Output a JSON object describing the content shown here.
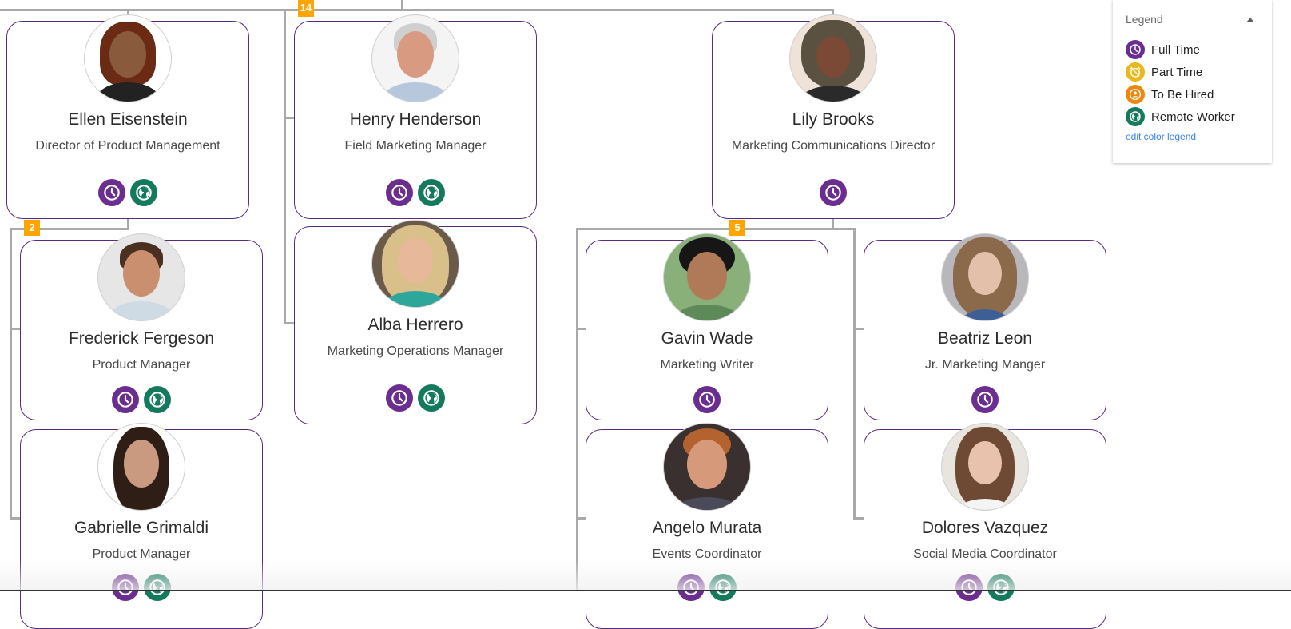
{
  "legend": {
    "title": "Legend",
    "items": [
      {
        "label": "Full Time",
        "icon": "clock-icon",
        "color": "#6b2d8f"
      },
      {
        "label": "Part Time",
        "icon": "alarm-off-icon",
        "color": "#e8b81c"
      },
      {
        "label": "To Be Hired",
        "icon": "person-icon",
        "color": "#f0870c"
      },
      {
        "label": "Remote Worker",
        "icon": "globe-icon",
        "color": "#137a5e"
      }
    ],
    "edit_link": "edit color legend"
  },
  "badges": {
    "top_group_count": "14",
    "ellen_reports_count": "2",
    "lily_reports_count": "5"
  },
  "people": [
    {
      "id": "ellen",
      "name": "Ellen Eisenstein",
      "title": "Director of Product Management",
      "status": [
        "full-time",
        "remote"
      ]
    },
    {
      "id": "henry",
      "name": "Henry Henderson",
      "title": "Field Marketing Manager",
      "status": [
        "full-time",
        "remote"
      ]
    },
    {
      "id": "lily",
      "name": "Lily Brooks",
      "title": "Marketing Communications Director",
      "status": [
        "full-time"
      ]
    },
    {
      "id": "frederick",
      "name": "Frederick Fergeson",
      "title": "Product Manager",
      "status": [
        "full-time",
        "remote"
      ]
    },
    {
      "id": "alba",
      "name": "Alba Herrero",
      "title": "Marketing Operations Manager",
      "status": [
        "full-time",
        "remote"
      ]
    },
    {
      "id": "gavin",
      "name": "Gavin Wade",
      "title": "Marketing Writer",
      "status": [
        "full-time"
      ]
    },
    {
      "id": "beatriz",
      "name": "Beatriz Leon",
      "title": "Jr. Marketing Manger",
      "status": [
        "full-time"
      ]
    },
    {
      "id": "gabrielle",
      "name": "Gabrielle Grimaldi",
      "title": "Product Manager",
      "status": [
        "full-time",
        "remote"
      ]
    },
    {
      "id": "angelo",
      "name": "Angelo Murata",
      "title": "Events Coordinator",
      "status": [
        "full-time",
        "remote"
      ]
    },
    {
      "id": "dolores",
      "name": "Dolores Vazquez",
      "title": "Social Media Coordinator",
      "status": [
        "full-time",
        "remote"
      ]
    }
  ],
  "colors": {
    "full_time": "#6b2d8f",
    "remote": "#137a5e",
    "card_border": "#5b2a7d",
    "connector": "#a9a9a9",
    "count_badge": "#ffa500"
  }
}
